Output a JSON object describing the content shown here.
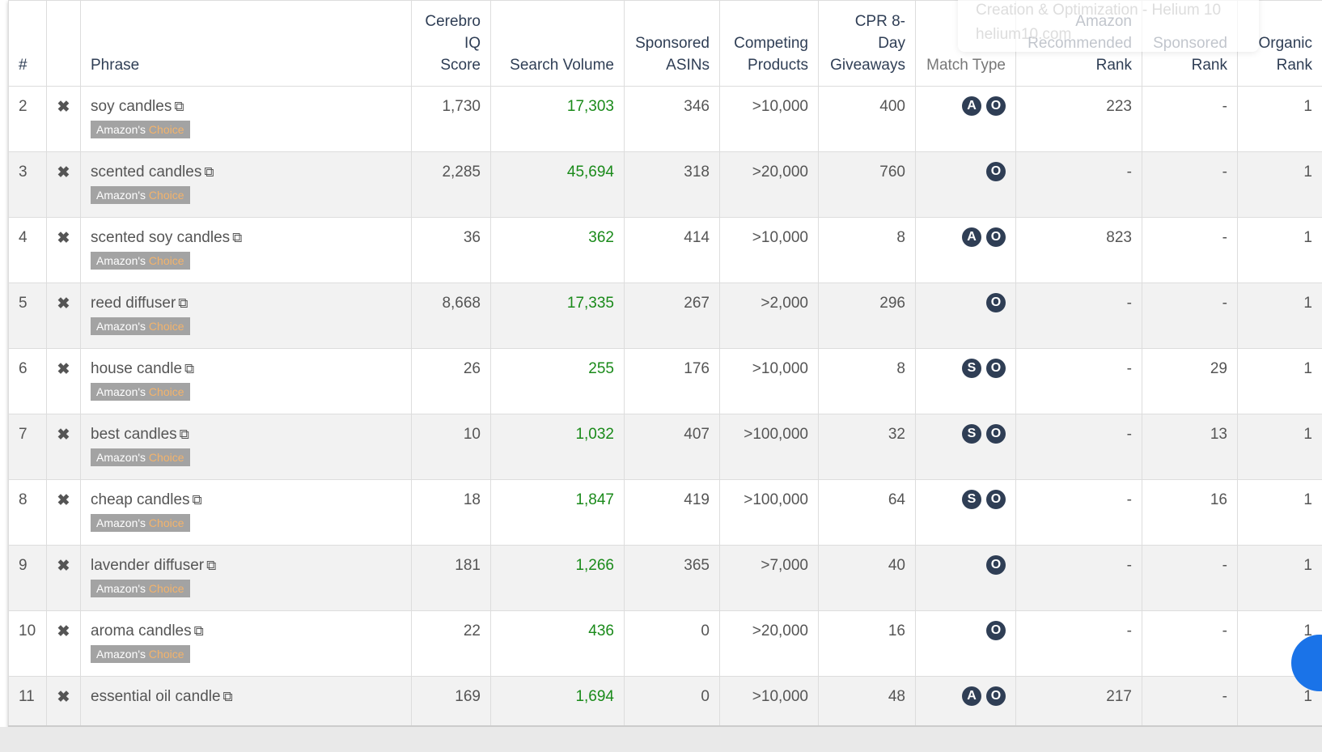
{
  "headers": [
    "#",
    "",
    "Phrase",
    "Cerebro IQ Score",
    "Search Volume",
    "Sponsored ASINs",
    "Competing Products",
    "CPR 8-Day Giveaways",
    "Match Type",
    "Amazon Recommended Rank",
    "Sponsored Rank",
    "Organic Rank"
  ],
  "tooltip": {
    "title": "Creation & Optimization - Helium 10",
    "url": "helium10.com"
  },
  "badge": {
    "prefix": "Amazon's",
    "suffix": "Choice"
  },
  "rows": [
    {
      "n": "2",
      "phrase": "soy candles",
      "iq": "1,730",
      "sv": "17,303",
      "asins": "346",
      "comp": ">10,000",
      "cpr": "400",
      "match": [
        "A",
        "O"
      ],
      "amz": "223",
      "spon": "-",
      "org": "1",
      "choice": true
    },
    {
      "n": "3",
      "phrase": "scented candles",
      "iq": "2,285",
      "sv": "45,694",
      "asins": "318",
      "comp": ">20,000",
      "cpr": "760",
      "match": [
        "O"
      ],
      "amz": "-",
      "spon": "-",
      "org": "1",
      "choice": true
    },
    {
      "n": "4",
      "phrase": "scented soy candles",
      "iq": "36",
      "sv": "362",
      "asins": "414",
      "comp": ">10,000",
      "cpr": "8",
      "match": [
        "A",
        "O"
      ],
      "amz": "823",
      "spon": "-",
      "org": "1",
      "choice": true
    },
    {
      "n": "5",
      "phrase": "reed diffuser",
      "iq": "8,668",
      "sv": "17,335",
      "asins": "267",
      "comp": ">2,000",
      "cpr": "296",
      "match": [
        "O"
      ],
      "amz": "-",
      "spon": "-",
      "org": "1",
      "choice": true
    },
    {
      "n": "6",
      "phrase": "house candle",
      "iq": "26",
      "sv": "255",
      "asins": "176",
      "comp": ">10,000",
      "cpr": "8",
      "match": [
        "S",
        "O"
      ],
      "amz": "-",
      "spon": "29",
      "org": "1",
      "choice": true
    },
    {
      "n": "7",
      "phrase": "best candles",
      "iq": "10",
      "sv": "1,032",
      "asins": "407",
      "comp": ">100,000",
      "cpr": "32",
      "match": [
        "S",
        "O"
      ],
      "amz": "-",
      "spon": "13",
      "org": "1",
      "choice": true
    },
    {
      "n": "8",
      "phrase": "cheap candles",
      "iq": "18",
      "sv": "1,847",
      "asins": "419",
      "comp": ">100,000",
      "cpr": "64",
      "match": [
        "S",
        "O"
      ],
      "amz": "-",
      "spon": "16",
      "org": "1",
      "choice": true
    },
    {
      "n": "9",
      "phrase": "lavender diffuser",
      "iq": "181",
      "sv": "1,266",
      "asins": "365",
      "comp": ">7,000",
      "cpr": "40",
      "match": [
        "O"
      ],
      "amz": "-",
      "spon": "-",
      "org": "1",
      "choice": true
    },
    {
      "n": "10",
      "phrase": "aroma candles",
      "iq": "22",
      "sv": "436",
      "asins": "0",
      "comp": ">20,000",
      "cpr": "16",
      "match": [
        "O"
      ],
      "amz": "-",
      "spon": "-",
      "org": "1",
      "choice": true
    },
    {
      "n": "11",
      "phrase": "essential oil candle",
      "iq": "169",
      "sv": "1,694",
      "asins": "0",
      "comp": ">10,000",
      "cpr": "48",
      "match": [
        "A",
        "O"
      ],
      "amz": "217",
      "spon": "-",
      "org": "1",
      "choice": false
    }
  ]
}
